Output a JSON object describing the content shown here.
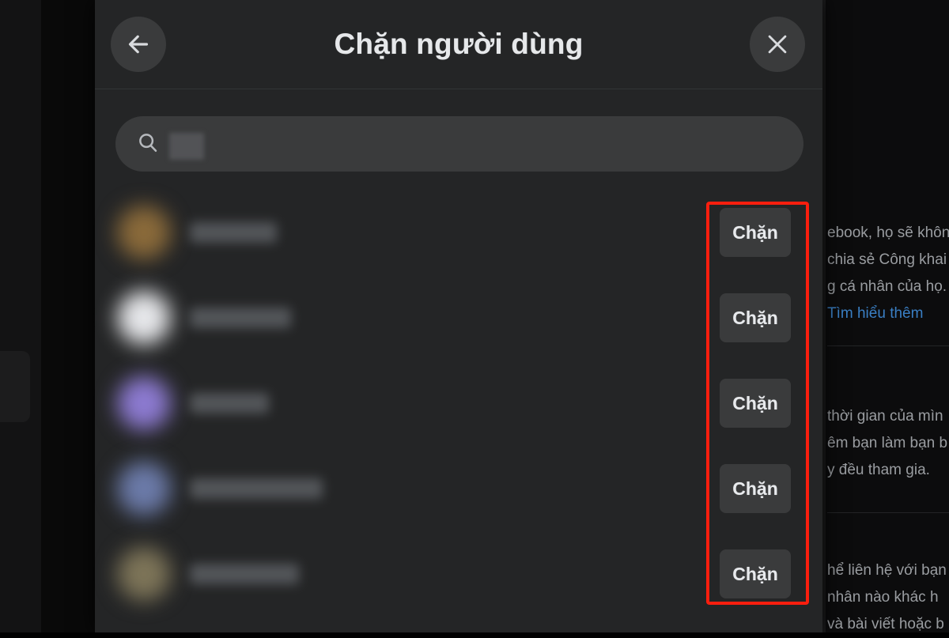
{
  "dialog": {
    "title": "Chặn người dùng",
    "back_button_label": "Quay lại",
    "back_icon": "arrow-left-icon",
    "close_button_label": "Đóng",
    "close_icon": "close-icon",
    "search": {
      "icon": "search-icon",
      "value": "",
      "placeholder": "",
      "censored": true
    },
    "list": {
      "items": [
        {
          "name": "",
          "avatar_color": "#8a6a3a",
          "name_width": 110,
          "censored": true,
          "action_label": "Chặn"
        },
        {
          "name": "",
          "avatar_color": "#e6e7ea",
          "name_width": 128,
          "censored": true,
          "action_label": "Chặn"
        },
        {
          "name": "",
          "avatar_color": "#8c7ad0",
          "name_width": 100,
          "censored": true,
          "action_label": "Chặn"
        },
        {
          "name": "",
          "avatar_color": "#6b7aa8",
          "name_width": 168,
          "censored": true,
          "action_label": "Chặn"
        },
        {
          "name": "",
          "avatar_color": "#7d7458",
          "name_width": 138,
          "censored": true,
          "action_label": "Chặn"
        }
      ]
    }
  },
  "annotation": {
    "shape": "rectangle",
    "color": "#fa1e0e",
    "target": "block-buttons-column"
  },
  "background": {
    "blocks": [
      {
        "lines": [
          "ebook, họ sẽ khôn",
          "chia sẻ Công khai",
          "g cá nhân của họ.",
          "Tìm hiểu thêm"
        ],
        "link_line_index": 3
      },
      {
        "lines": [
          "thời gian của mìn",
          "êm bạn làm bạn b",
          "y đều tham gia."
        ],
        "link_line_index": -1
      },
      {
        "lines": [
          "hể liên hệ với bạn",
          "nhân nào khác h",
          "và bài viết hoặc b"
        ],
        "link_line_index": -1
      }
    ]
  }
}
